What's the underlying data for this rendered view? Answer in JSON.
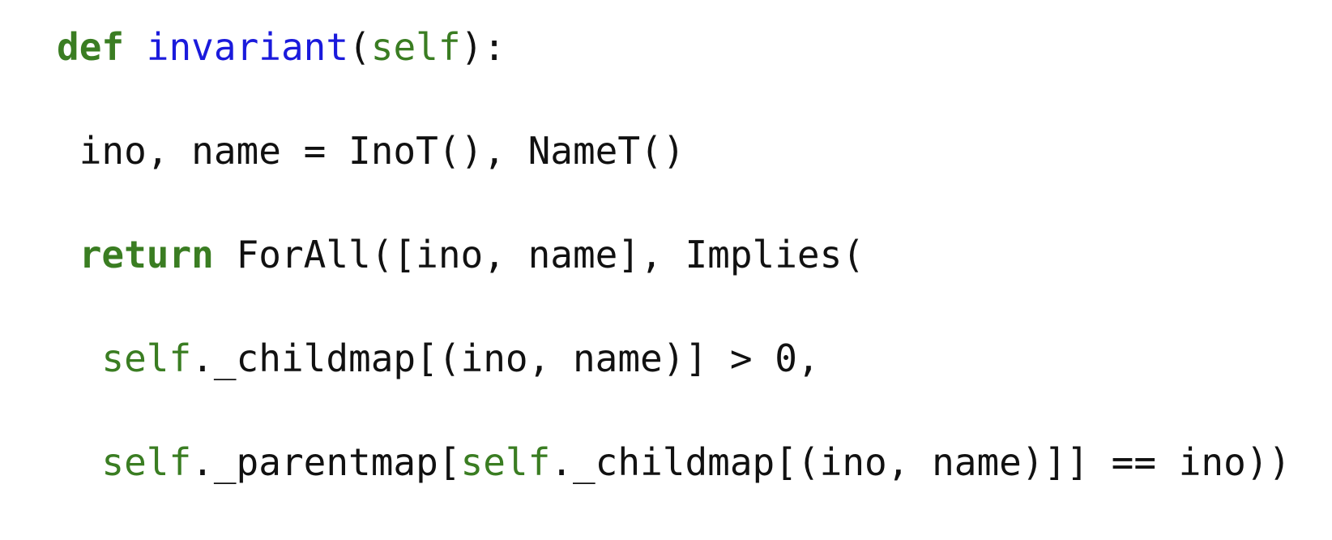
{
  "code_lines": [
    [
      {
        "text": "def",
        "kind": "keyword"
      },
      {
        "text": " ",
        "kind": "plain"
      },
      {
        "text": "invariant",
        "kind": "function"
      },
      {
        "text": "(",
        "kind": "plain"
      },
      {
        "text": "self",
        "kind": "self"
      },
      {
        "text": "):",
        "kind": "plain"
      }
    ],
    [
      {
        "text": " ino, name = InoT(), NameT()",
        "kind": "plain"
      }
    ],
    [
      {
        "text": " ",
        "kind": "plain"
      },
      {
        "text": "return",
        "kind": "keyword"
      },
      {
        "text": " ForAll([ino, name], Implies(",
        "kind": "plain"
      }
    ],
    [
      {
        "text": "  ",
        "kind": "plain"
      },
      {
        "text": "self",
        "kind": "self"
      },
      {
        "text": "._childmap[(ino, name)] > 0,",
        "kind": "plain"
      }
    ],
    [
      {
        "text": "  ",
        "kind": "plain"
      },
      {
        "text": "self",
        "kind": "self"
      },
      {
        "text": "._parentmap[",
        "kind": "plain"
      },
      {
        "text": "self",
        "kind": "self"
      },
      {
        "text": "._childmap[(ino, name)]] == ino))",
        "kind": "plain"
      }
    ]
  ],
  "colors": {
    "keyword": "#3a7d22",
    "function": "#1a1adc",
    "self": "#3a7d22",
    "plain": "#111111",
    "background": "#ffffff"
  }
}
